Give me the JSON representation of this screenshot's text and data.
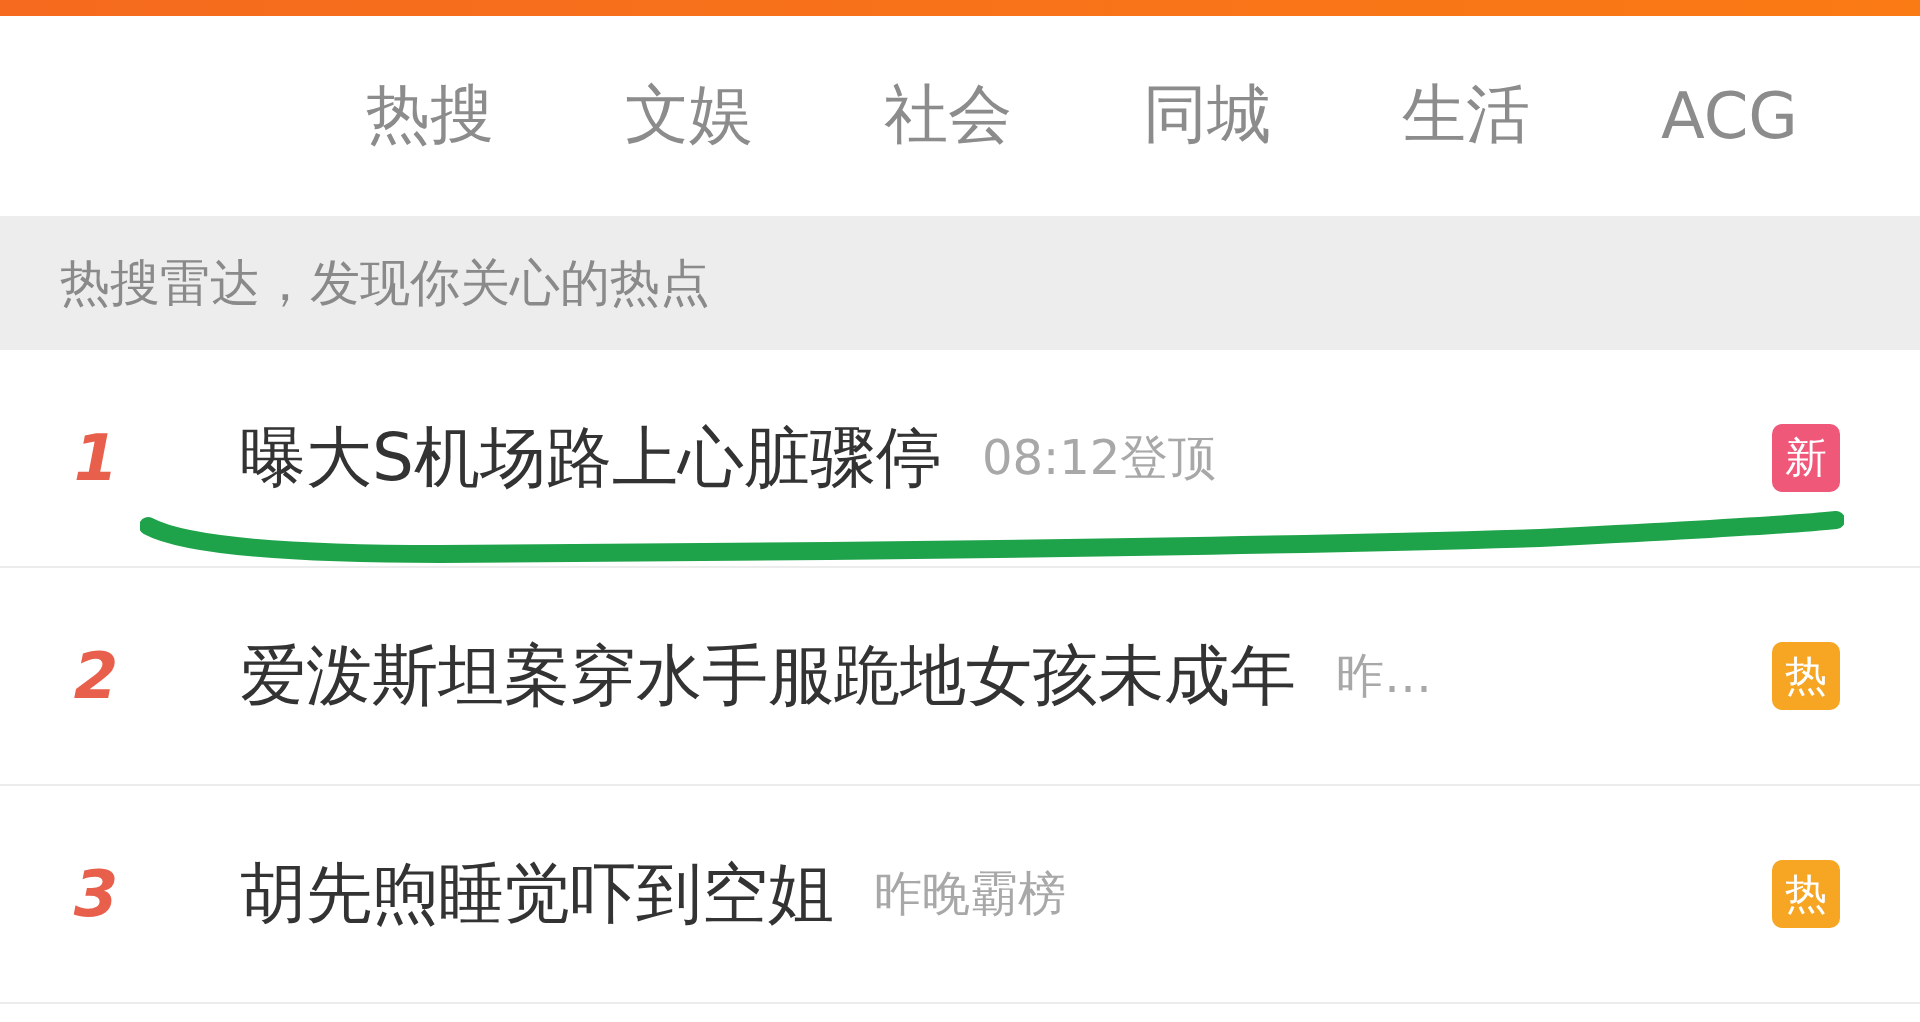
{
  "tabs": [
    {
      "label": "热搜"
    },
    {
      "label": "文娱"
    },
    {
      "label": "社会"
    },
    {
      "label": "同城"
    },
    {
      "label": "生活"
    },
    {
      "label": "ACG"
    }
  ],
  "banner": {
    "text": "热搜雷达，发现你关心的热点"
  },
  "items": [
    {
      "rank": "1",
      "title": "曝大S机场路上心脏骤停",
      "meta": "08:12登顶",
      "badge": "新",
      "color": "#f0587a",
      "underlined": true
    },
    {
      "rank": "2",
      "title": "爱泼斯坦案穿水手服跪地女孩未成年",
      "meta": "昨…",
      "badge": "热",
      "color": "#f7a623",
      "underlined": false
    },
    {
      "rank": "3",
      "title": "胡先煦睡觉吓到空姐",
      "meta": "昨晚霸榜",
      "badge": "热",
      "color": "#f7a623",
      "underlined": false
    }
  ]
}
